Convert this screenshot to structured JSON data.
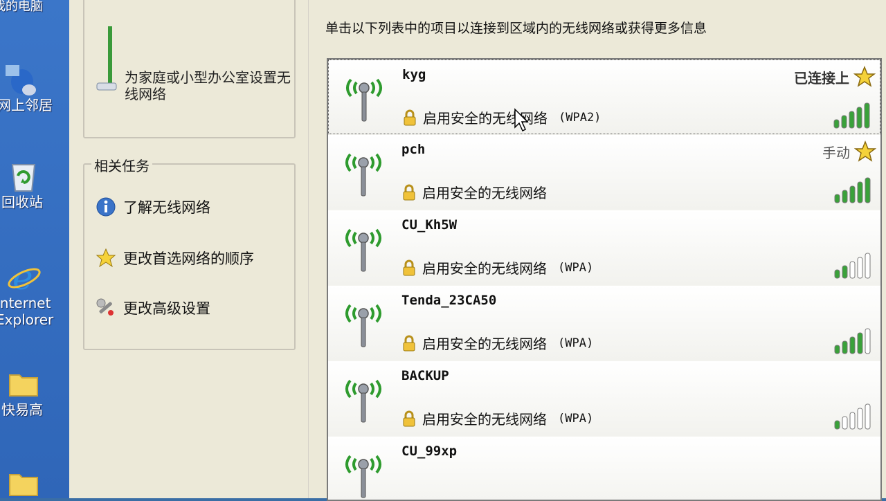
{
  "desktop": {
    "icons": [
      {
        "name": "my-computer",
        "label": "我的电脑"
      },
      {
        "name": "network-places",
        "label": "网上邻居"
      },
      {
        "name": "recycle-bin",
        "label": "回收站"
      },
      {
        "name": "internet-explorer",
        "label": "Internet Explorer"
      },
      {
        "name": "folder",
        "label": "快易高"
      }
    ]
  },
  "tasks": {
    "setup_text": "为家庭或小型办公室设置无线网络",
    "related_title": "相关任务",
    "items": [
      {
        "label": "了解无线网络",
        "icon": "info-icon"
      },
      {
        "label": "更改首选网络的顺序",
        "icon": "star-icon"
      },
      {
        "label": "更改高级设置",
        "icon": "wrench-icon"
      }
    ]
  },
  "main": {
    "instruction": "单击以下列表中的项目以连接到区域内的无线网络或获得更多信息",
    "networks": [
      {
        "ssid": "kyg",
        "security": "启用安全的无线网络",
        "mode": "(WPA2)",
        "status": "已连接上",
        "starred": true,
        "signal": 5,
        "selected": true
      },
      {
        "ssid": "pch",
        "security": "启用安全的无线网络",
        "mode": "",
        "status": "手动",
        "starred": true,
        "signal": 5,
        "selected": false
      },
      {
        "ssid": "CU_Kh5W",
        "security": "启用安全的无线网络",
        "mode": "(WPA)",
        "status": "",
        "starred": false,
        "signal": 2,
        "selected": false
      },
      {
        "ssid": "Tenda_23CA50",
        "security": "启用安全的无线网络",
        "mode": "(WPA)",
        "status": "",
        "starred": false,
        "signal": 4,
        "selected": false
      },
      {
        "ssid": "BACKUP",
        "security": "启用安全的无线网络",
        "mode": "(WPA)",
        "status": "",
        "starred": false,
        "signal": 1,
        "selected": false
      },
      {
        "ssid": "CU_99xp",
        "security": "",
        "mode": "",
        "status": "",
        "starred": false,
        "signal": 0,
        "selected": false
      }
    ]
  },
  "colors": {
    "signal_on": "#3aa13a",
    "signal_off": "#ffffff",
    "antenna_wave": "#2e9b2e",
    "star": "#f5d23a"
  }
}
